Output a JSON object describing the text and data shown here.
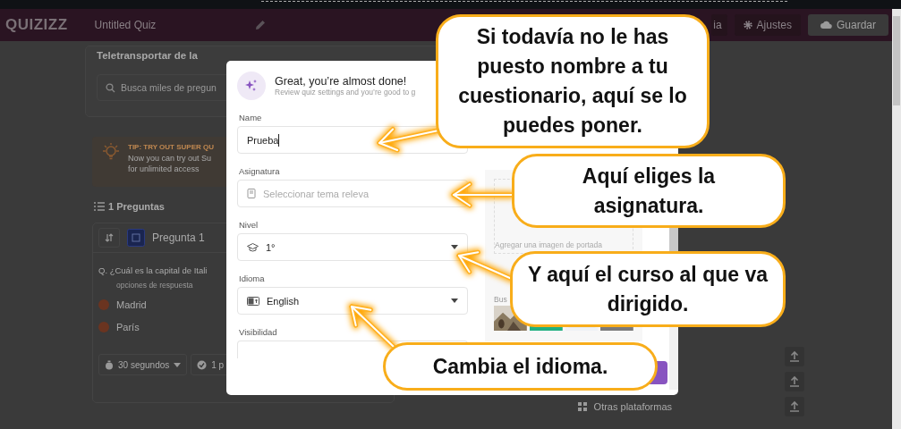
{
  "header": {
    "logo": "QUIZIZZ",
    "quiz_title": "Untitled Quiz",
    "buttons": [
      {
        "kind": "partial",
        "label": "ia"
      },
      {
        "kind": "settings",
        "label": "Ajustes"
      },
      {
        "kind": "save",
        "label": "Guardar"
      }
    ]
  },
  "library": {
    "title": "Teletransportar de la",
    "search_placeholder": "Busca miles de pregun"
  },
  "tip": {
    "title": "TIP: TRY OUT SUPER QU",
    "lines": [
      "Now you can try out Su",
      "for unlimited access"
    ]
  },
  "questions": {
    "count": "1 Preguntas",
    "label": "Pregunta 1",
    "text": "Q. ¿Cuál es la capital de Itali",
    "options_label": "opciones de respuesta",
    "options": [
      "Madrid",
      "París"
    ],
    "time": "30 segundos",
    "points": "1 p"
  },
  "side": {
    "platforms": "Otras plataformas"
  },
  "modal": {
    "title": "Great, you’re almost done!",
    "subtitle": "Review quiz settings and you’re good to g",
    "fields": [
      {
        "kind": "text",
        "label": "Name",
        "value": "Prueba"
      },
      {
        "kind": "subject",
        "label": "Asignatura",
        "placeholder": "Seleccionar tema releva"
      },
      {
        "kind": "grade",
        "label": "Nivel",
        "value": "1°"
      },
      {
        "kind": "language",
        "label": "Idioma",
        "value": "English"
      },
      {
        "kind": "cut",
        "label": "Visibilidad"
      }
    ],
    "cover": {
      "placeholder": "Agregar una imagen de portada",
      "search_label": "Bus"
    }
  },
  "callouts": [
    {
      "text": "Si todavía no le has puesto nombre a tu cuestionario, aquí se lo puedes poner."
    },
    {
      "text": "Aquí eliges la asignatura."
    },
    {
      "text": "Y aquí el curso al que va dirigido."
    },
    {
      "text": "Cambia el idioma."
    }
  ]
}
